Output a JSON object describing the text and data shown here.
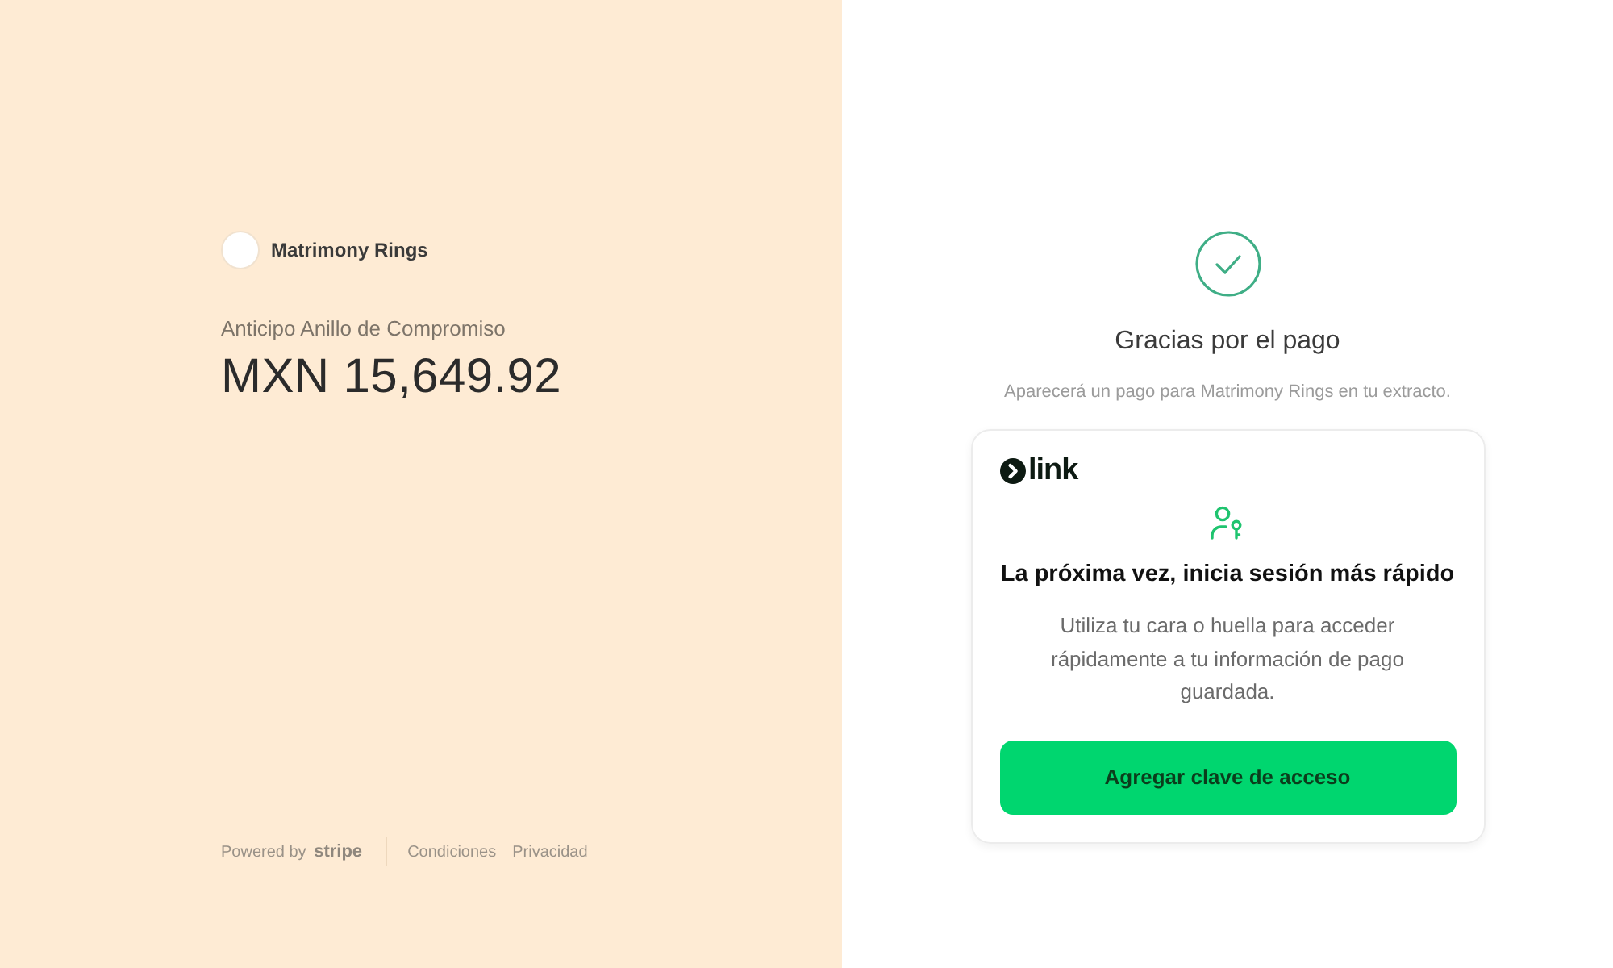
{
  "merchant": {
    "name": "Matrimony Rings"
  },
  "product": {
    "name": "Anticipo Anillo de Compromiso",
    "amount": "MXN 15,649.92"
  },
  "footer": {
    "powered_by": "Powered by",
    "brand": "stripe",
    "links": [
      "Condiciones",
      "Privacidad"
    ]
  },
  "confirmation": {
    "title": "Gracias por el pago",
    "subtitle": "Aparecerá un pago para Matrimony Rings en tu extracto."
  },
  "link_card": {
    "brand": "link",
    "heading": "La próxima vez, inicia sesión más rápido",
    "description": "Utiliza tu cara o huella para acceder rápidamente a tu información de pago guardada.",
    "button": "Agregar clave de acceso"
  }
}
